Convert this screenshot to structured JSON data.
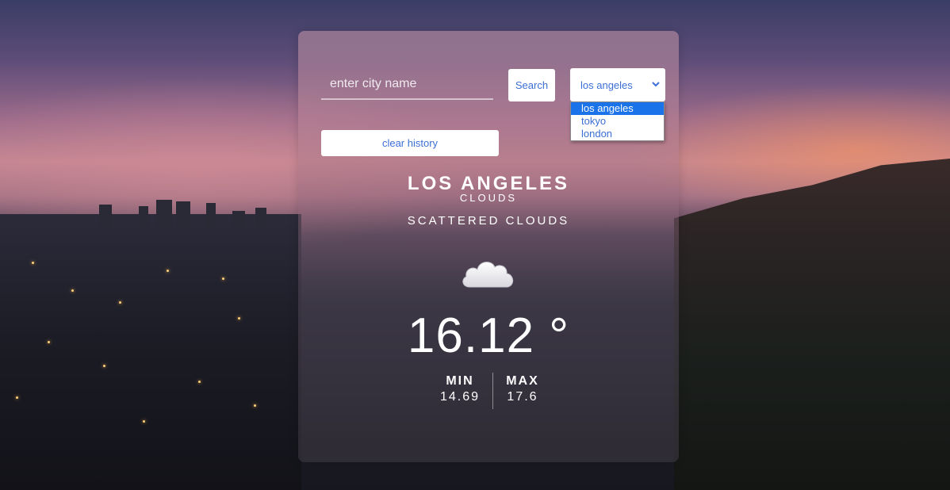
{
  "search": {
    "placeholder": "enter city name",
    "button_label": "Search"
  },
  "history_select": {
    "selected": "los angeles",
    "options": [
      "los angeles",
      "tokyo",
      "london"
    ]
  },
  "clear_history_label": "clear history",
  "weather": {
    "city": "LOS ANGELES",
    "main": "CLOUDS",
    "description": "SCATTERED CLOUDS",
    "icon": "cloud-icon",
    "temperature": "16.12 °",
    "min_label": "MIN",
    "min_value": "14.69",
    "max_label": "MAX",
    "max_value": "17.6"
  },
  "colors": {
    "accent": "#3b6fd6",
    "selected_option": "#1a73e8"
  }
}
